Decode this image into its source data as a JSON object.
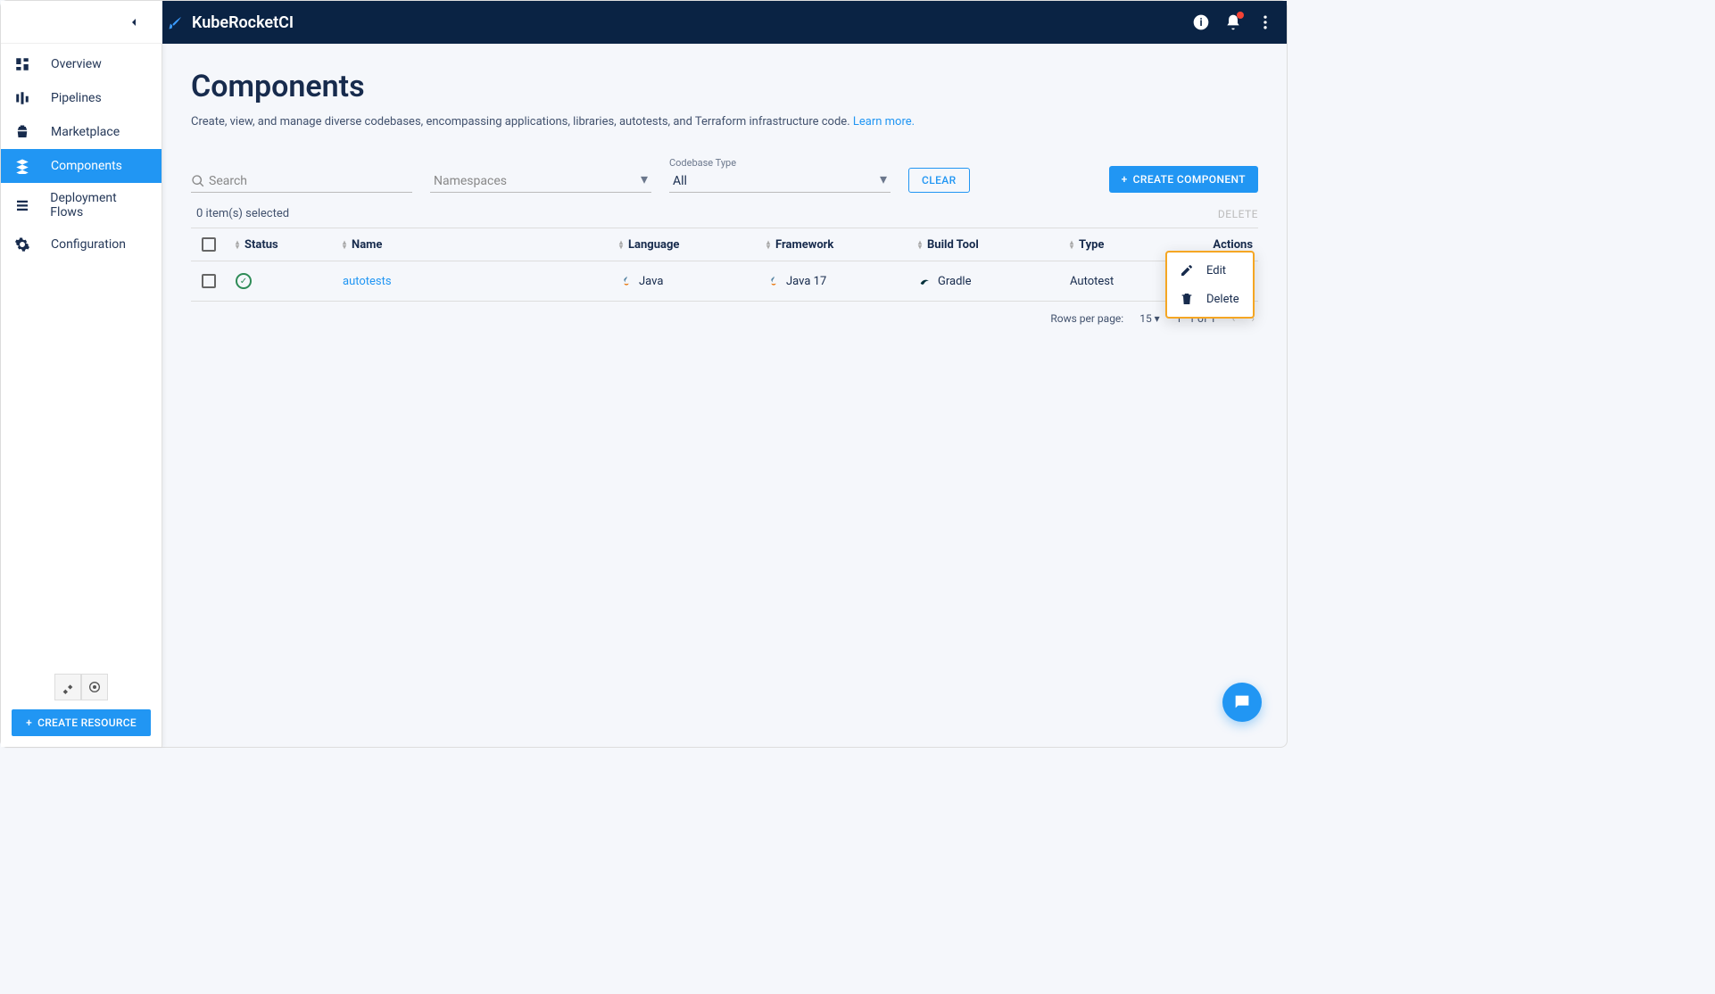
{
  "app": {
    "name": "KubeRocketCI"
  },
  "sidebar": {
    "items": [
      {
        "label": "Overview"
      },
      {
        "label": "Pipelines"
      },
      {
        "label": "Marketplace"
      },
      {
        "label": "Components"
      },
      {
        "label": "Deployment Flows"
      },
      {
        "label": "Configuration"
      }
    ],
    "create_resource": "CREATE RESOURCE"
  },
  "page": {
    "title": "Components",
    "description": "Create, view, and manage diverse codebases, encompassing applications, libraries, autotests, and Terraform infrastructure code.",
    "learn_more": "Learn more."
  },
  "filters": {
    "search_placeholder": "Search",
    "namespaces_label": "Namespaces",
    "codebase_type_label": "Codebase Type",
    "codebase_type_value": "All",
    "clear": "CLEAR",
    "create_component": "CREATE COMPONENT"
  },
  "selection": {
    "text": "0 item(s) selected",
    "delete": "DELETE"
  },
  "table": {
    "headers": {
      "status": "Status",
      "name": "Name",
      "language": "Language",
      "framework": "Framework",
      "build_tool": "Build Tool",
      "type": "Type",
      "actions": "Actions"
    },
    "rows": [
      {
        "name": "autotests",
        "language": "Java",
        "framework": "Java 17",
        "build_tool": "Gradle",
        "type": "Autotest"
      }
    ]
  },
  "pagination": {
    "rows_label": "Rows per page:",
    "rows_value": "15",
    "range": "1–1 of 1"
  },
  "context_menu": {
    "edit": "Edit",
    "delete": "Delete"
  }
}
